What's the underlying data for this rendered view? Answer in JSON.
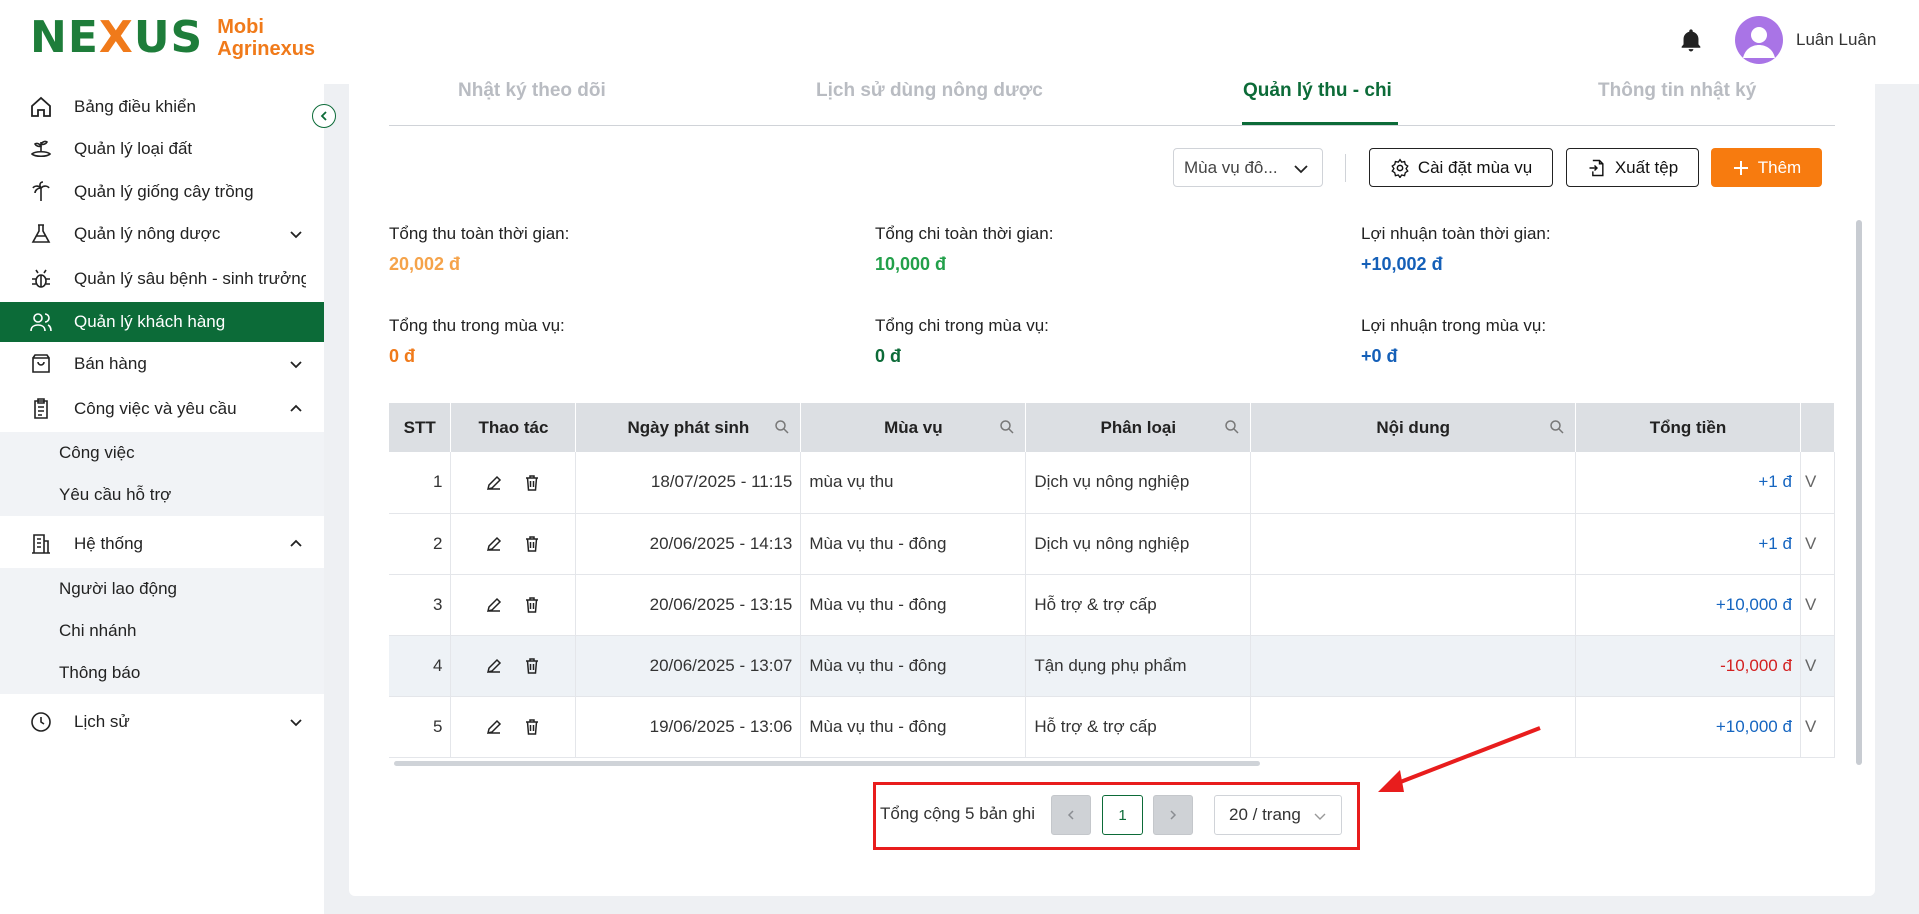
{
  "brand": {
    "mark_left": "NE",
    "mark_x": "X",
    "mark_right": "US",
    "name_line1": "Mobi",
    "name_line2": "Agrinexus"
  },
  "user": {
    "name": "Luân Luân"
  },
  "sidebar": {
    "items": [
      {
        "label": "Bảng điều khiển",
        "icon": "home-icon"
      },
      {
        "label": "Quản lý loại đất",
        "icon": "soil-icon"
      },
      {
        "label": "Quản lý giống cây trồng",
        "icon": "palm-tree-icon"
      },
      {
        "label": "Quản lý nông dược",
        "icon": "flask-icon"
      },
      {
        "label": "Quản lý sâu bệnh - sinh trưởng",
        "icon": "bug-icon"
      },
      {
        "label": "Quản lý khách hàng",
        "icon": "users-icon"
      },
      {
        "label": "Bán hàng",
        "icon": "shopping-bag-icon"
      },
      {
        "label": "Công việc và yêu cầu",
        "icon": "clipboard-icon"
      },
      {
        "label": "Hệ thống",
        "icon": "building-icon"
      },
      {
        "label": "Lịch sử",
        "icon": "clock-icon"
      }
    ],
    "sub_work": [
      "Công việc",
      "Yêu cầu hỗ trợ"
    ],
    "sub_system": [
      "Người lao động",
      "Chi nhánh",
      "Thông báo"
    ]
  },
  "tabs": [
    "Nhật ký theo dõi",
    "Lịch sử dùng nông dược",
    "Quản lý thu - chi",
    "Thông tin nhật ký"
  ],
  "toolbar": {
    "season_select": "Mùa vụ đô...",
    "season_settings": "Cài đặt mùa vụ",
    "export": "Xuất tệp",
    "add": "Thêm"
  },
  "stats": {
    "total_income_all_label": "Tổng thu toàn thời gian:",
    "total_income_all": "20,002 đ",
    "total_expense_all_label": "Tổng chi toàn thời gian:",
    "total_expense_all": "10,000 đ",
    "profit_all_label": "Lợi nhuận toàn thời gian:",
    "profit_all": "+10,002 đ",
    "total_income_season_label": "Tổng thu trong mùa vụ:",
    "total_income_season": "0 đ",
    "total_expense_season_label": "Tổng chi trong mùa vụ:",
    "total_expense_season": "0 đ",
    "profit_season_label": "Lợi nhuận trong mùa vụ:",
    "profit_season": "+0 đ"
  },
  "table": {
    "headers": [
      "STT",
      "Thao tác",
      "Ngày phát sinh",
      "Mùa vụ",
      "Phân loại",
      "Nội dung",
      "Tổng tiền"
    ],
    "rows": [
      {
        "stt": "1",
        "date": "18/07/2025 - 11:15",
        "season": "mùa vụ thu",
        "category": "Dịch vụ nông nghiệp",
        "content": "",
        "total": "+1 đ"
      },
      {
        "stt": "2",
        "date": "20/06/2025 - 14:13",
        "season": "Mùa vụ thu - đông",
        "category": "Dịch vụ nông nghiệp",
        "content": "",
        "total": "+1 đ"
      },
      {
        "stt": "3",
        "date": "20/06/2025 - 13:15",
        "season": "Mùa vụ thu - đông",
        "category": "Hỗ trợ & trợ cấp",
        "content": "",
        "total": "+10,000 đ"
      },
      {
        "stt": "4",
        "date": "20/06/2025 - 13:07",
        "season": "Mùa vụ thu - đông",
        "category": "Tận dụng phụ phẩm",
        "content": "",
        "total": "-10,000 đ"
      },
      {
        "stt": "5",
        "date": "19/06/2025 - 13:06",
        "season": "Mùa vụ thu - đông",
        "category": "Hỗ trợ & trợ cấp",
        "content": "",
        "total": "+10,000 đ"
      }
    ],
    "trailing_glyph": "V"
  },
  "pagination": {
    "total_text": "Tổng cộng 5 bản ghi",
    "current_page": "1",
    "page_size": "20 / trang"
  },
  "colors": {
    "primary_green": "#0c6b38",
    "accent_orange": "#f77b0f",
    "positive_blue": "#1565c0",
    "negative_red": "#d32020",
    "annotation_red": "#e81d1d"
  }
}
